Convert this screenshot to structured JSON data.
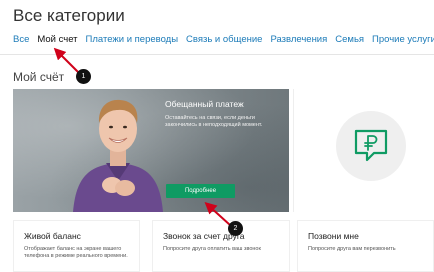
{
  "page": {
    "title": "Все категории"
  },
  "tabs": [
    {
      "label": "Все"
    },
    {
      "label": "Мой счет"
    },
    {
      "label": "Платежи и переводы"
    },
    {
      "label": "Связь и общение"
    },
    {
      "label": "Развлечения"
    },
    {
      "label": "Семья"
    },
    {
      "label": "Прочие услуги"
    }
  ],
  "section": {
    "title": "Мой счёт"
  },
  "hero": {
    "heading": "Обещанный платеж",
    "text": "Оставайтесь на связи, если деньги закончились в неподходящий момент.",
    "button_label": "Подробнее"
  },
  "side_card": {
    "icon": "ruble-chat-icon",
    "accent": "#0f9b63"
  },
  "cards": [
    {
      "title": "Живой баланс",
      "text": "Отображает баланс на экране вашего телефона в режиме реального времени."
    },
    {
      "title": "Звонок за счет друга",
      "text": "Попросите друга оплатить ваш звонок"
    },
    {
      "title": "Позвони мне",
      "text": "Попросите друга вам перезвонить"
    }
  ],
  "annotations": [
    {
      "label": "1"
    },
    {
      "label": "2"
    }
  ],
  "colors": {
    "link": "#1c7bb8",
    "brand_green": "#0f9b63",
    "annotation_red": "#d0021b"
  }
}
